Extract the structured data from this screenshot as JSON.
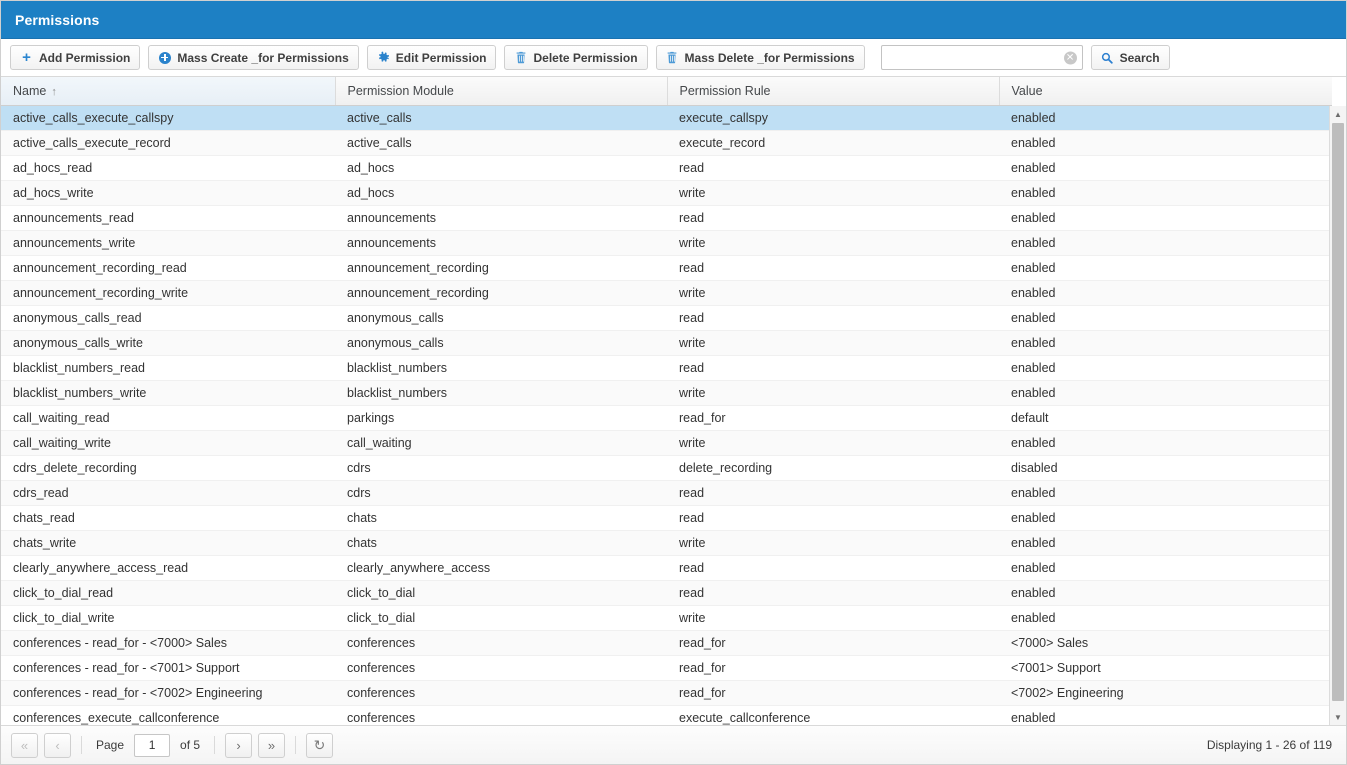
{
  "window": {
    "title": "Permissions"
  },
  "toolbar": {
    "buttons": [
      {
        "label": "Add Permission",
        "icon": "plus-icon"
      },
      {
        "label": "Mass Create _for Permissions",
        "icon": "circle-plus-icon"
      },
      {
        "label": "Edit Permission",
        "icon": "gear-icon"
      },
      {
        "label": "Delete Permission",
        "icon": "trash-icon"
      },
      {
        "label": "Mass Delete _for Permissions",
        "icon": "trash-icon"
      }
    ],
    "search": {
      "value": "",
      "placeholder": "",
      "clear_icon": "clear-circle-icon",
      "button_label": "Search",
      "button_icon": "search-icon"
    }
  },
  "grid": {
    "columns": [
      {
        "label": "Name",
        "sorted": true,
        "sort_dir": "↑"
      },
      {
        "label": "Permission Module",
        "sorted": false,
        "sort_dir": ""
      },
      {
        "label": "Permission Rule",
        "sorted": false,
        "sort_dir": ""
      },
      {
        "label": "Value",
        "sorted": false,
        "sort_dir": ""
      }
    ],
    "selected_row_index": 0,
    "rows": [
      {
        "name": "active_calls_execute_callspy",
        "module": "active_calls",
        "rule": "execute_callspy",
        "value": "enabled",
        "value_state": "enabled"
      },
      {
        "name": "active_calls_execute_record",
        "module": "active_calls",
        "rule": "execute_record",
        "value": "enabled",
        "value_state": "enabled"
      },
      {
        "name": "ad_hocs_read",
        "module": "ad_hocs",
        "rule": "read",
        "value": "enabled",
        "value_state": "enabled"
      },
      {
        "name": "ad_hocs_write",
        "module": "ad_hocs",
        "rule": "write",
        "value": "enabled",
        "value_state": "enabled"
      },
      {
        "name": "announcements_read",
        "module": "announcements",
        "rule": "read",
        "value": "enabled",
        "value_state": "enabled"
      },
      {
        "name": "announcements_write",
        "module": "announcements",
        "rule": "write",
        "value": "enabled",
        "value_state": "enabled"
      },
      {
        "name": "announcement_recording_read",
        "module": "announcement_recording",
        "rule": "read",
        "value": "enabled",
        "value_state": "enabled"
      },
      {
        "name": "announcement_recording_write",
        "module": "announcement_recording",
        "rule": "write",
        "value": "enabled",
        "value_state": "enabled"
      },
      {
        "name": "anonymous_calls_read",
        "module": "anonymous_calls",
        "rule": "read",
        "value": "enabled",
        "value_state": "enabled"
      },
      {
        "name": "anonymous_calls_write",
        "module": "anonymous_calls",
        "rule": "write",
        "value": "enabled",
        "value_state": "enabled"
      },
      {
        "name": "blacklist_numbers_read",
        "module": "blacklist_numbers",
        "rule": "read",
        "value": "enabled",
        "value_state": "enabled"
      },
      {
        "name": "blacklist_numbers_write",
        "module": "blacklist_numbers",
        "rule": "write",
        "value": "enabled",
        "value_state": "enabled"
      },
      {
        "name": "call_waiting_read",
        "module": "parkings",
        "rule": "read_for",
        "value": "default",
        "value_state": "plain"
      },
      {
        "name": "call_waiting_write",
        "module": "call_waiting",
        "rule": "write",
        "value": "enabled",
        "value_state": "enabled"
      },
      {
        "name": "cdrs_delete_recording",
        "module": "cdrs",
        "rule": "delete_recording",
        "value": "disabled",
        "value_state": "disabled"
      },
      {
        "name": "cdrs_read",
        "module": "cdrs",
        "rule": "read",
        "value": "enabled",
        "value_state": "enabled"
      },
      {
        "name": "chats_read",
        "module": "chats",
        "rule": "read",
        "value": "enabled",
        "value_state": "enabled"
      },
      {
        "name": "chats_write",
        "module": "chats",
        "rule": "write",
        "value": "enabled",
        "value_state": "enabled"
      },
      {
        "name": "clearly_anywhere_access_read",
        "module": "clearly_anywhere_access",
        "rule": "read",
        "value": "enabled",
        "value_state": "enabled"
      },
      {
        "name": "click_to_dial_read",
        "module": "click_to_dial",
        "rule": "read",
        "value": "enabled",
        "value_state": "enabled"
      },
      {
        "name": "click_to_dial_write",
        "module": "click_to_dial",
        "rule": "write",
        "value": "enabled",
        "value_state": "enabled"
      },
      {
        "name": "conferences - read_for - <7000> Sales",
        "module": "conferences",
        "rule": "read_for",
        "value": "<7000> Sales",
        "value_state": "plain"
      },
      {
        "name": "conferences - read_for - <7001> Support",
        "module": "conferences",
        "rule": "read_for",
        "value": "<7001> Support",
        "value_state": "plain"
      },
      {
        "name": "conferences - read_for - <7002> Engineering",
        "module": "conferences",
        "rule": "read_for",
        "value": "<7002> Engineering",
        "value_state": "plain"
      },
      {
        "name": "conferences_execute_callconference",
        "module": "conferences",
        "rule": "execute_callconference",
        "value": "enabled",
        "value_state": "enabled"
      }
    ]
  },
  "pager": {
    "first_label": "«",
    "prev_label": "‹",
    "page_label": "Page",
    "page_value": "1",
    "of_label": "of 5",
    "next_label": "›",
    "last_label": "»",
    "refresh_icon": "refresh-icon",
    "displaying": "Displaying 1 - 26 of 119"
  }
}
